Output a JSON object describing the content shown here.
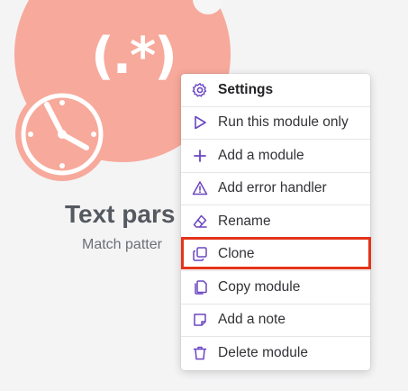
{
  "module": {
    "title": "Text pars",
    "subtitle": "Match patter",
    "icon_glyph": "(.*)",
    "colors": {
      "bubble": "#f7a99b",
      "accent": "#6b46c1",
      "highlight": "#e3341b"
    }
  },
  "menu": {
    "items": [
      {
        "label": "Settings",
        "icon": "gear-icon"
      },
      {
        "label": "Run this module only",
        "icon": "play-icon"
      },
      {
        "label": "Add a module",
        "icon": "plus-icon"
      },
      {
        "label": "Add error handler",
        "icon": "warning-icon"
      },
      {
        "label": "Rename",
        "icon": "eraser-icon"
      },
      {
        "label": "Clone",
        "icon": "clone-icon"
      },
      {
        "label": "Copy module",
        "icon": "copy-icon"
      },
      {
        "label": "Add a note",
        "icon": "note-icon"
      },
      {
        "label": "Delete module",
        "icon": "trash-icon"
      }
    ]
  }
}
